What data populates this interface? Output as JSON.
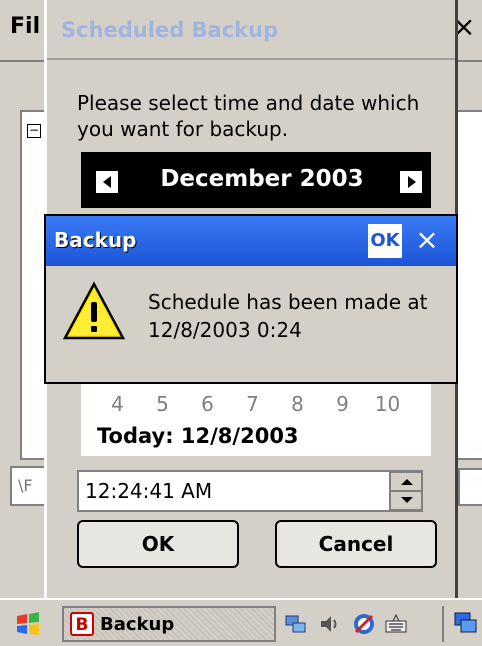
{
  "background_app": {
    "title_fragment": "Fil",
    "close_glyph": "×",
    "tree_toggle": "−",
    "path_fragment": "\\F"
  },
  "scheduled_dialog": {
    "title": "Scheduled Backup",
    "instructions": "Please select time and date which you want for backup.",
    "calendar": {
      "month_year": "December 2003",
      "visible_days": [
        "4",
        "5",
        "6",
        "7",
        "8",
        "9",
        "10"
      ],
      "today_label": "Today: 12/8/2003"
    },
    "time_value": "12:24:41 AM",
    "ok_label": "OK",
    "cancel_label": "Cancel"
  },
  "message_box": {
    "title": "Backup",
    "ok_label": "OK",
    "close_glyph": "×",
    "message": "Schedule has been made at 12/8/2003 0:24",
    "icon": "warning-icon"
  },
  "taskbar": {
    "task_label": "Backup",
    "task_icon_letter": "B",
    "tray_icons": [
      "network-icon",
      "volume-icon",
      "sync-icon",
      "keyboard-icon"
    ]
  },
  "colors": {
    "titlebar_blue": "#1c55d6",
    "dialog_gray": "#d4d0c8",
    "calendar_header": "#000000"
  }
}
